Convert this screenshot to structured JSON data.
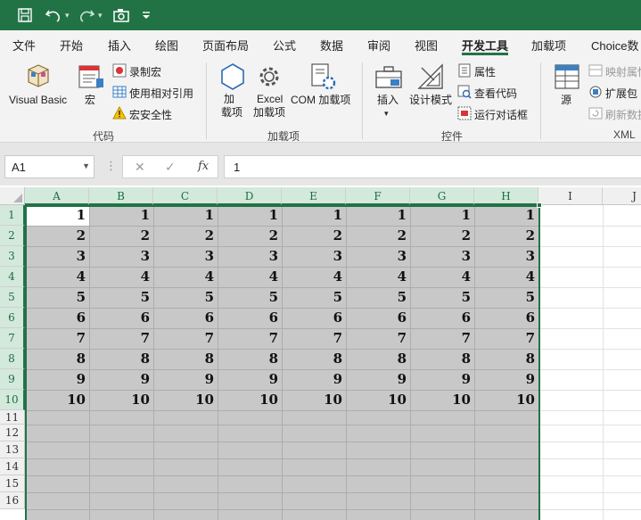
{
  "title_bar": {
    "icons": [
      "save-icon",
      "undo-icon",
      "redo-icon",
      "camera-icon",
      "customize-qat-icon"
    ]
  },
  "ribbon_tabs": [
    "文件",
    "开始",
    "插入",
    "绘图",
    "页面布局",
    "公式",
    "数据",
    "审阅",
    "视图",
    "开发工具",
    "加载项",
    "Choice数"
  ],
  "active_tab": "开发工具",
  "groups": {
    "code": {
      "label": "代码",
      "visual_basic": "Visual Basic",
      "macros": "宏",
      "record_macro": "录制宏",
      "relative_refs": "使用相对引用",
      "macro_security": "宏安全性"
    },
    "addins": {
      "label": "加载项",
      "addins_line1": "加",
      "addins_line2": "载项",
      "excel_addins_line1": "Excel",
      "excel_addins_line2": "加载项",
      "com_addins": "COM 加载项"
    },
    "controls": {
      "label": "控件",
      "insert": "插入",
      "design_mode": "设计模式",
      "properties": "属性",
      "view_code": "查看代码",
      "run_dialog": "运行对话框"
    },
    "xml": {
      "label": "XML",
      "source": "源",
      "map_properties": "映射属性",
      "expansion_packs": "扩展包",
      "refresh_data": "刷新数据"
    }
  },
  "formula_bar": {
    "name_box": "A1",
    "fx_label": "fx",
    "value": "1"
  },
  "columns": [
    "A",
    "B",
    "C",
    "D",
    "E",
    "F",
    "G",
    "H",
    "I",
    "J"
  ],
  "rows": [
    "1",
    "2",
    "3",
    "4",
    "5",
    "6",
    "7",
    "8",
    "9",
    "10",
    "11",
    "12",
    "13",
    "14",
    "15",
    "16"
  ],
  "cell_values": [
    "1",
    "2",
    "3",
    "4",
    "5",
    "6",
    "7",
    "8",
    "9",
    "10"
  ],
  "colors": {
    "excel_green": "#217346",
    "selection_fill": "#c8c8c8",
    "header_selected": "#d3e9dc"
  }
}
